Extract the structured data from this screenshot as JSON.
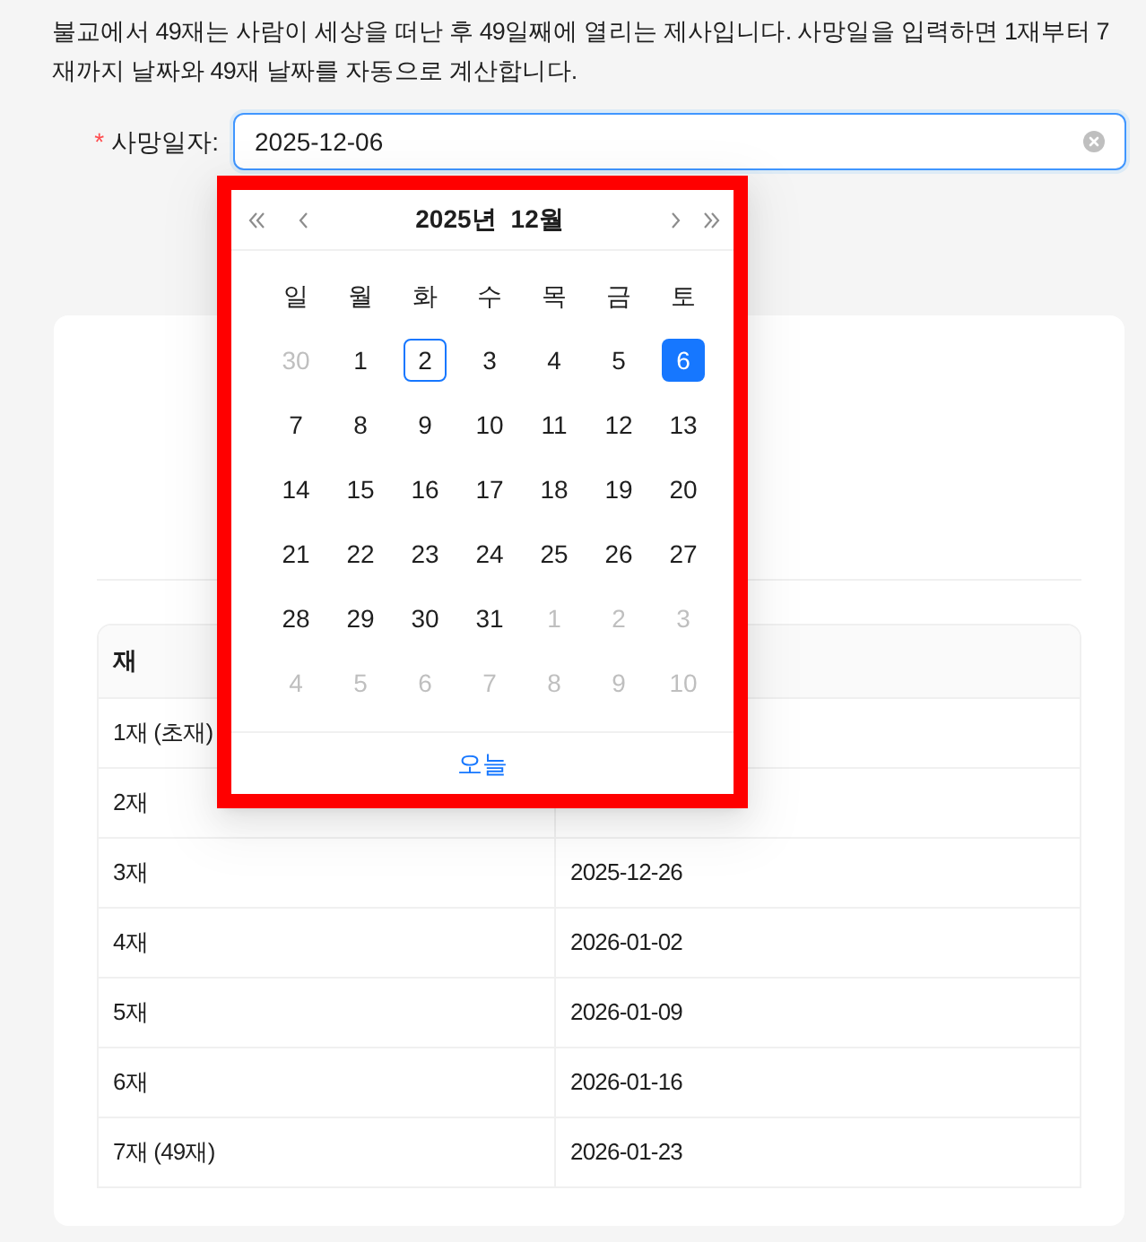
{
  "description": "불교에서 49재는 사람이 세상을 떠난 후 49일째에 열리는 제사입니다. 사망일을 입력하면 1재부터 7재까지 날짜와 49재 날짜를 자동으로 계산합니다.",
  "form": {
    "required_mark": "*",
    "label": "사망일자:",
    "value": "2025-12-06",
    "focused": true
  },
  "date_picker": {
    "highlighted": true,
    "year": "2025년",
    "month": "12월",
    "weekdays": [
      "일",
      "월",
      "화",
      "수",
      "목",
      "금",
      "토"
    ],
    "weeks": [
      {
        "days": [
          {
            "day": "30",
            "in_month": false,
            "selected": false,
            "today": false
          },
          {
            "day": "1",
            "in_month": true,
            "selected": false,
            "today": false
          },
          {
            "day": "2",
            "in_month": true,
            "selected": false,
            "today": true
          },
          {
            "day": "3",
            "in_month": true,
            "selected": false,
            "today": false
          },
          {
            "day": "4",
            "in_month": true,
            "selected": false,
            "today": false
          },
          {
            "day": "5",
            "in_month": true,
            "selected": false,
            "today": false
          },
          {
            "day": "6",
            "in_month": true,
            "selected": true,
            "today": false
          }
        ]
      },
      {
        "days": [
          {
            "day": "7",
            "in_month": true,
            "selected": false,
            "today": false
          },
          {
            "day": "8",
            "in_month": true,
            "selected": false,
            "today": false
          },
          {
            "day": "9",
            "in_month": true,
            "selected": false,
            "today": false
          },
          {
            "day": "10",
            "in_month": true,
            "selected": false,
            "today": false
          },
          {
            "day": "11",
            "in_month": true,
            "selected": false,
            "today": false
          },
          {
            "day": "12",
            "in_month": true,
            "selected": false,
            "today": false
          },
          {
            "day": "13",
            "in_month": true,
            "selected": false,
            "today": false
          }
        ]
      },
      {
        "days": [
          {
            "day": "14",
            "in_month": true,
            "selected": false,
            "today": false
          },
          {
            "day": "15",
            "in_month": true,
            "selected": false,
            "today": false
          },
          {
            "day": "16",
            "in_month": true,
            "selected": false,
            "today": false
          },
          {
            "day": "17",
            "in_month": true,
            "selected": false,
            "today": false
          },
          {
            "day": "18",
            "in_month": true,
            "selected": false,
            "today": false
          },
          {
            "day": "19",
            "in_month": true,
            "selected": false,
            "today": false
          },
          {
            "day": "20",
            "in_month": true,
            "selected": false,
            "today": false
          }
        ]
      },
      {
        "days": [
          {
            "day": "21",
            "in_month": true,
            "selected": false,
            "today": false
          },
          {
            "day": "22",
            "in_month": true,
            "selected": false,
            "today": false
          },
          {
            "day": "23",
            "in_month": true,
            "selected": false,
            "today": false
          },
          {
            "day": "24",
            "in_month": true,
            "selected": false,
            "today": false
          },
          {
            "day": "25",
            "in_month": true,
            "selected": false,
            "today": false
          },
          {
            "day": "26",
            "in_month": true,
            "selected": false,
            "today": false
          },
          {
            "day": "27",
            "in_month": true,
            "selected": false,
            "today": false
          }
        ]
      },
      {
        "days": [
          {
            "day": "28",
            "in_month": true,
            "selected": false,
            "today": false
          },
          {
            "day": "29",
            "in_month": true,
            "selected": false,
            "today": false
          },
          {
            "day": "30",
            "in_month": true,
            "selected": false,
            "today": false
          },
          {
            "day": "31",
            "in_month": true,
            "selected": false,
            "today": false
          },
          {
            "day": "1",
            "in_month": false,
            "selected": false,
            "today": false
          },
          {
            "day": "2",
            "in_month": false,
            "selected": false,
            "today": false
          },
          {
            "day": "3",
            "in_month": false,
            "selected": false,
            "today": false
          }
        ]
      },
      {
        "days": [
          {
            "day": "4",
            "in_month": false,
            "selected": false,
            "today": false
          },
          {
            "day": "5",
            "in_month": false,
            "selected": false,
            "today": false
          },
          {
            "day": "6",
            "in_month": false,
            "selected": false,
            "today": false
          },
          {
            "day": "7",
            "in_month": false,
            "selected": false,
            "today": false
          },
          {
            "day": "8",
            "in_month": false,
            "selected": false,
            "today": false
          },
          {
            "day": "9",
            "in_month": false,
            "selected": false,
            "today": false
          },
          {
            "day": "10",
            "in_month": false,
            "selected": false,
            "today": false
          }
        ]
      }
    ],
    "today_link": "오늘"
  },
  "results_table": {
    "columns": [
      "재"
    ],
    "rows": [
      {
        "cells": [
          "1재 (초재)"
        ]
      },
      {
        "cells": [
          "2재"
        ]
      },
      {
        "cells": [
          "3재",
          "2025-12-26"
        ]
      },
      {
        "cells": [
          "4재",
          "2026-01-02"
        ]
      },
      {
        "cells": [
          "5재",
          "2026-01-09"
        ]
      },
      {
        "cells": [
          "6재",
          "2026-01-16"
        ]
      },
      {
        "cells": [
          "7재 (49재)",
          "2026-01-23"
        ]
      }
    ]
  }
}
